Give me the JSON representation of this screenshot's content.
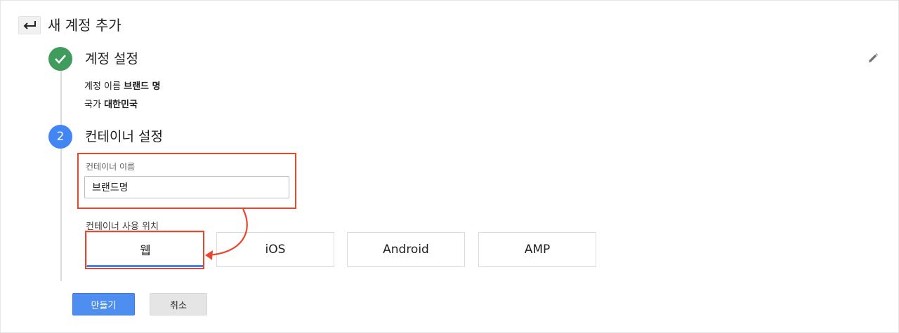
{
  "header": {
    "back_icon": "back-arrow-icon",
    "title": "새 계정 추가"
  },
  "step1": {
    "icon": "check-icon",
    "title": "계정 설정",
    "edit_icon": "pencil-icon",
    "account_label": "계정 이름",
    "account_value": "브랜드 명",
    "country_label": "국가",
    "country_value": "대한민국"
  },
  "step2": {
    "number": "2",
    "title": "컨테이너 설정",
    "name_label": "컨테이너 이름",
    "name_value": "브랜드명",
    "usage_label": "컨테이너 사용 위치",
    "platforms": [
      "웹",
      "iOS",
      "Android",
      "AMP"
    ],
    "selected_platform": "웹"
  },
  "actions": {
    "create": "만들기",
    "cancel": "취소"
  },
  "colors": {
    "accent": "#4285f4",
    "success": "#3f9c5c",
    "annotation": "#e8472e",
    "primary_button": "#4d8ef0"
  }
}
